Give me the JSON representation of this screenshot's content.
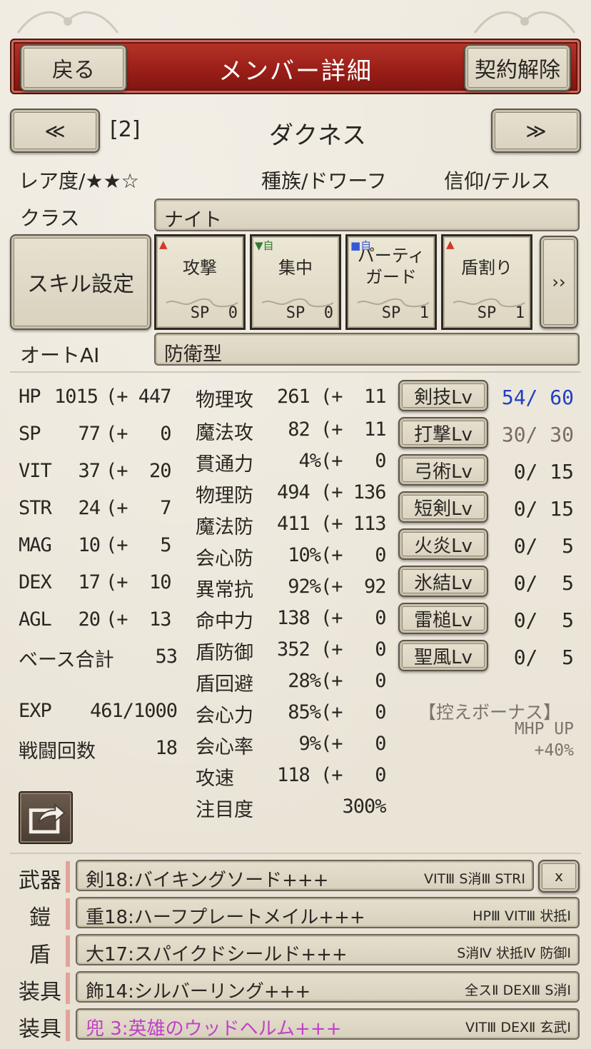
{
  "header": {
    "back_label": "戻る",
    "title": "メンバー詳細",
    "release_label": "契約解除"
  },
  "nav": {
    "prev_label": "≪",
    "next_label": "≫",
    "index": "[2]",
    "name": "ダクネス"
  },
  "info": {
    "rarity_label": "レア度/",
    "rarity_stars_filled": "★★",
    "rarity_stars_empty": "☆",
    "race": "種族/ドワーフ",
    "faith": "信仰/テルス"
  },
  "class_row": {
    "label": "クラス",
    "value": "ナイト"
  },
  "skills": {
    "setting_label": "スキル設定",
    "more_label": "››",
    "cards": [
      {
        "tag": "▲",
        "tag_color": "#d0392b",
        "name": "攻撃",
        "sp": "SP  0"
      },
      {
        "tag": "▼自",
        "tag_color": "#2e7d32",
        "name": "集中",
        "sp": "SP  0"
      },
      {
        "tag": "■自",
        "tag_color": "#3559d6",
        "name": "パーティ\nガード",
        "sp": "SP  1"
      },
      {
        "tag": "▲",
        "tag_color": "#d0392b",
        "name": "盾割り",
        "sp": "SP  1"
      }
    ]
  },
  "auto_ai": {
    "label": "オートAI",
    "value": "防衛型"
  },
  "base_stats": [
    {
      "name": "HP",
      "value": "1015",
      "bonus": "(+ 447"
    },
    {
      "name": "SP",
      "value": "77",
      "bonus": "(+   0"
    },
    {
      "name": "VIT",
      "value": "37",
      "bonus": "(+  20"
    },
    {
      "name": "STR",
      "value": "24",
      "bonus": "(+   7"
    },
    {
      "name": "MAG",
      "value": "10",
      "bonus": "(+   5"
    },
    {
      "name": "DEX",
      "value": "17",
      "bonus": "(+  10"
    },
    {
      "name": "AGL",
      "value": "20",
      "bonus": "(+  13"
    }
  ],
  "base_total": {
    "label": "ベース合計",
    "value": "53"
  },
  "exp": {
    "label": "EXP",
    "value": "461/1000"
  },
  "battles": {
    "label": "戦闘回数",
    "value": "18"
  },
  "combat_stats": [
    {
      "name": "物理攻",
      "value": "261 (+  11"
    },
    {
      "name": "魔法攻",
      "value": " 82 (+  11"
    },
    {
      "name": "貫通力",
      "value": "  4%(+   0"
    },
    {
      "name": "物理防",
      "value": "494 (+ 136"
    },
    {
      "name": "魔法防",
      "value": "411 (+ 113"
    },
    {
      "name": "会心防",
      "value": " 10%(+   0"
    },
    {
      "name": "異常抗",
      "value": " 92%(+  92"
    },
    {
      "name": "命中力",
      "value": "138 (+   0"
    },
    {
      "name": "盾防御",
      "value": "352 (+   0"
    },
    {
      "name": "盾回避",
      "value": " 28%(+   0"
    },
    {
      "name": "会心力",
      "value": " 85%(+   0"
    },
    {
      "name": "会心率",
      "value": "  9%(+   0"
    },
    {
      "name": "攻速",
      "value": "118 (+   0"
    },
    {
      "name": "注目度",
      "value": "      300%"
    }
  ],
  "skill_levels": [
    {
      "label": "剣技Lv",
      "value": "54/ 60",
      "color": "#1f3fc4"
    },
    {
      "label": "打撃Lv",
      "value": "30/ 30",
      "color": "#7a6a64"
    },
    {
      "label": "弓術Lv",
      "value": " 0/ 15",
      "color": "#2a2622"
    },
    {
      "label": "短剣Lv",
      "value": " 0/ 15",
      "color": "#2a2622"
    },
    {
      "label": "火炎Lv",
      "value": " 0/  5",
      "color": "#2a2622"
    },
    {
      "label": "氷結Lv",
      "value": " 0/  5",
      "color": "#2a2622"
    },
    {
      "label": "雷槌Lv",
      "value": " 0/  5",
      "color": "#2a2622"
    },
    {
      "label": "聖風Lv",
      "value": " 0/  5",
      "color": "#2a2622"
    }
  ],
  "reserve_bonus": {
    "title": "【控えボーナス】",
    "line1": "MHP UP",
    "line2": "+40%"
  },
  "equipment": [
    {
      "slot": "武器",
      "name": "剣18:バイキングソード+++",
      "tags": "VITⅢ S消Ⅲ STRⅠ",
      "name_color": "#2a2622",
      "removable": true,
      "remove_label": "x"
    },
    {
      "slot": "鎧",
      "name": "重18:ハーフプレートメイル+++",
      "tags": "HPⅢ VITⅢ 状抵Ⅰ",
      "name_color": "#2a2622",
      "removable": false
    },
    {
      "slot": "盾",
      "name": "大17:スパイクドシールド+++",
      "tags": "S消Ⅳ 状抵Ⅳ 防御Ⅰ",
      "name_color": "#2a2622",
      "removable": false
    },
    {
      "slot": "装具",
      "name": "飾14:シルバーリング+++",
      "tags": "全スⅡ DEXⅢ S消Ⅰ",
      "name_color": "#2a2622",
      "removable": false
    },
    {
      "slot": "装具",
      "name": "兜 3:英雄のウッドヘルム+++",
      "tags": "VITⅢ DEXⅡ 玄武Ⅰ",
      "name_color": "#c23fc8",
      "removable": false
    }
  ],
  "icons": {
    "share": "share-icon"
  }
}
